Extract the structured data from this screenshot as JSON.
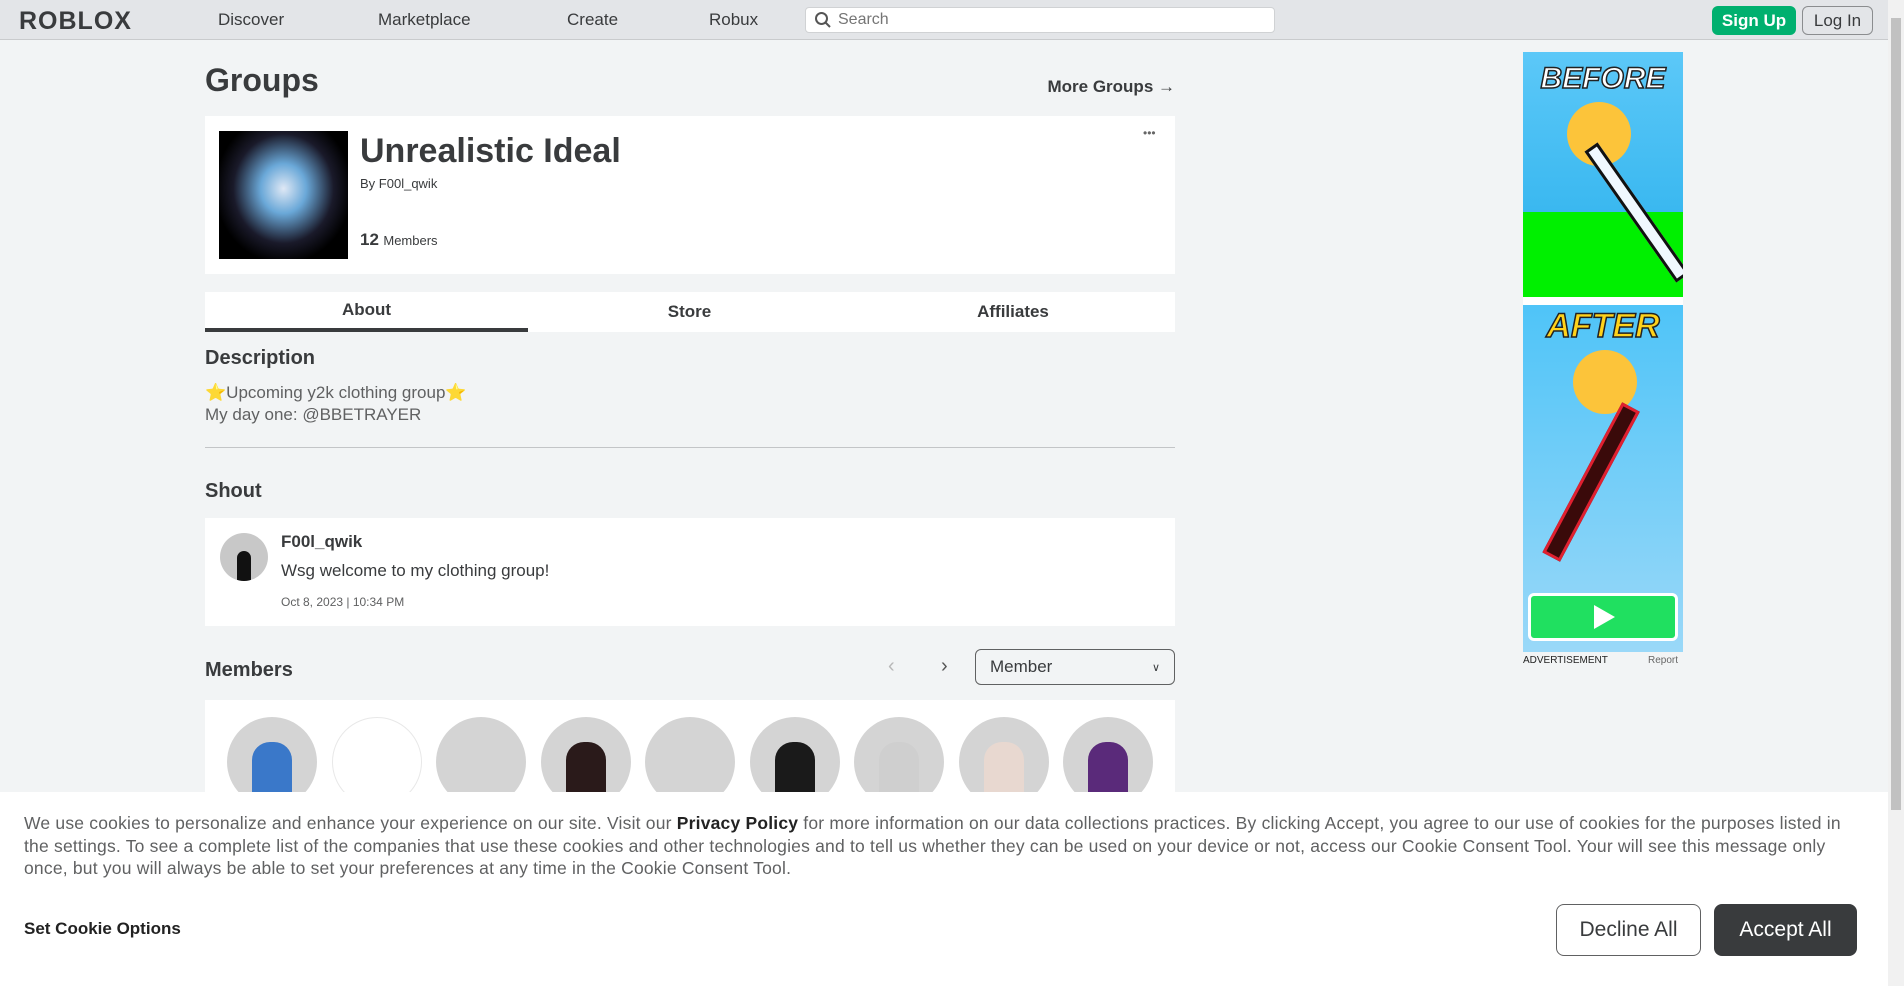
{
  "nav": {
    "logo": "ROBLOX",
    "links": [
      "Discover",
      "Marketplace",
      "Create",
      "Robux"
    ],
    "search_placeholder": "Search",
    "signup": "Sign Up",
    "login": "Log In"
  },
  "page": {
    "title": "Groups",
    "more_groups": "More Groups →"
  },
  "group": {
    "name": "Unrealistic Ideal",
    "by_label": "By",
    "owner": "F00l_qwik",
    "member_count": "12",
    "members_label": "Members",
    "menu": "•••"
  },
  "tabs": [
    "About",
    "Store",
    "Affiliates"
  ],
  "description": {
    "heading": "Description",
    "line1": "⭐Upcoming y2k clothing group⭐",
    "line2": "My day one: @BBETRAYER"
  },
  "shout": {
    "heading": "Shout",
    "author": "F00l_qwik",
    "message": "Wsg welcome to my clothing group!",
    "timestamp": "Oct 8, 2023 | 10:34 PM"
  },
  "members": {
    "heading": "Members",
    "role_select": "Member",
    "avatar_colors": [
      "#3a78c9",
      "#ffffff",
      "#d4d4d4",
      "#2a1a1a",
      "#d4d4d4",
      "#1a1a1a",
      "#cfcfcf",
      "#e8d8d0",
      "#5a2a7a"
    ]
  },
  "ad": {
    "before": "BEFORE",
    "after": "AFTER",
    "label": "ADVERTISEMENT",
    "report": "Report"
  },
  "cookie": {
    "text_before": "We use cookies to personalize and enhance your experience on our site. Visit our ",
    "privacy_link": "Privacy Policy",
    "text_after": " for more information on our data collections practices. By clicking Accept, you agree to our use of cookies for the purposes listed in the settings. To see a complete list of the companies that use these cookies and other technologies and to tell us whether they can be used on your device or not, access our Cookie Consent Tool. Your will see this message only once, but you will always be able to set your preferences at any time in the Cookie Consent Tool.",
    "options": "Set Cookie Options",
    "decline": "Decline All",
    "accept": "Accept All"
  }
}
